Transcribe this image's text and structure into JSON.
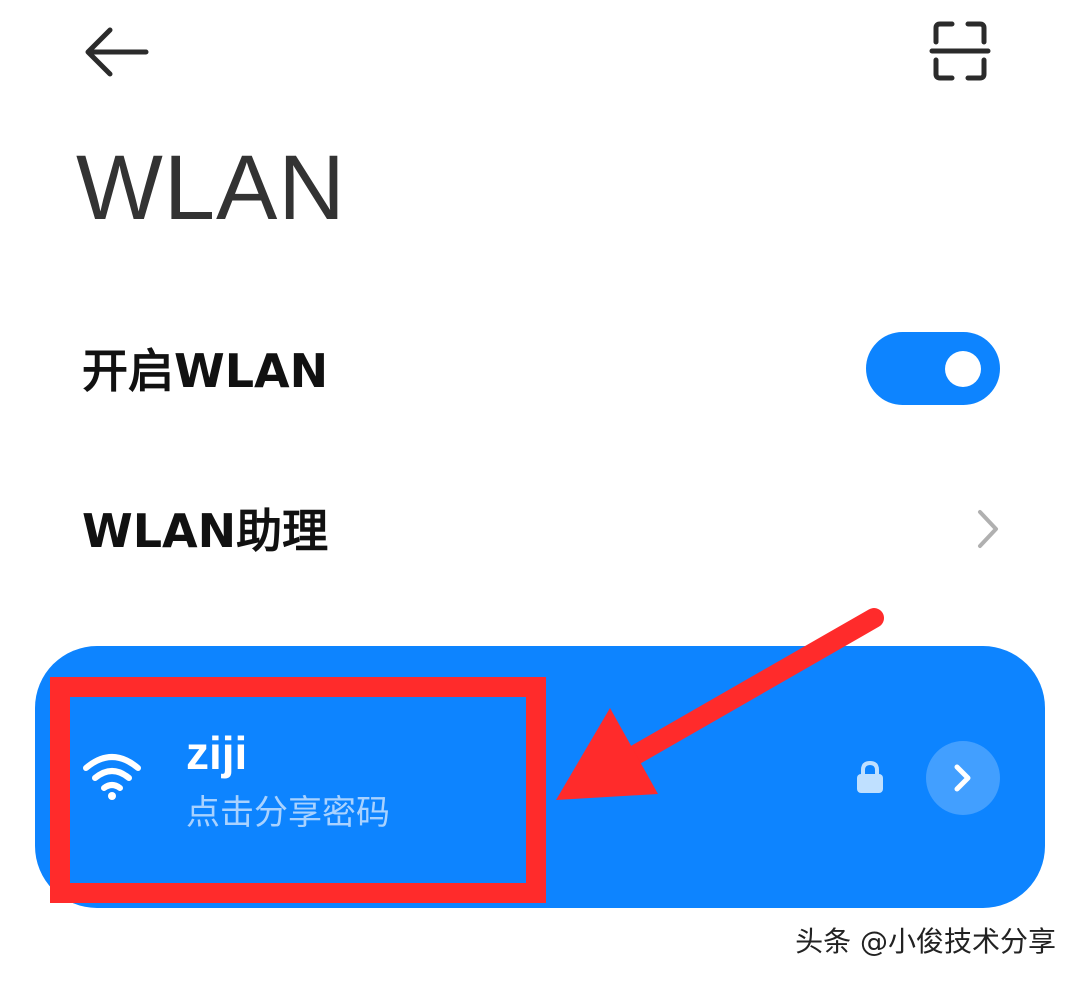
{
  "header": {
    "back_icon": "arrow-left-icon",
    "scan_icon": "scan-qr-icon"
  },
  "title": "WLAN",
  "settings": {
    "enable_wlan": {
      "label": "开启WLAN",
      "toggle_state": "on"
    },
    "wlan_assistant": {
      "label": "WLAN助理",
      "icon": "chevron-right-icon"
    }
  },
  "connected_network": {
    "name": "ziji",
    "subtitle": "点击分享密码",
    "signal_icon": "wifi-icon",
    "secured_icon": "lock-icon",
    "detail_icon": "chevron-right-icon"
  },
  "annotations": {
    "box_color": "#ff2b2b",
    "arrow_color": "#ff2b2b"
  },
  "watermark": "头条 @小俊技术分享",
  "colors": {
    "accent": "#0d84ff",
    "title_text": "#333333",
    "subtitle_text": "#a9d2ff"
  }
}
